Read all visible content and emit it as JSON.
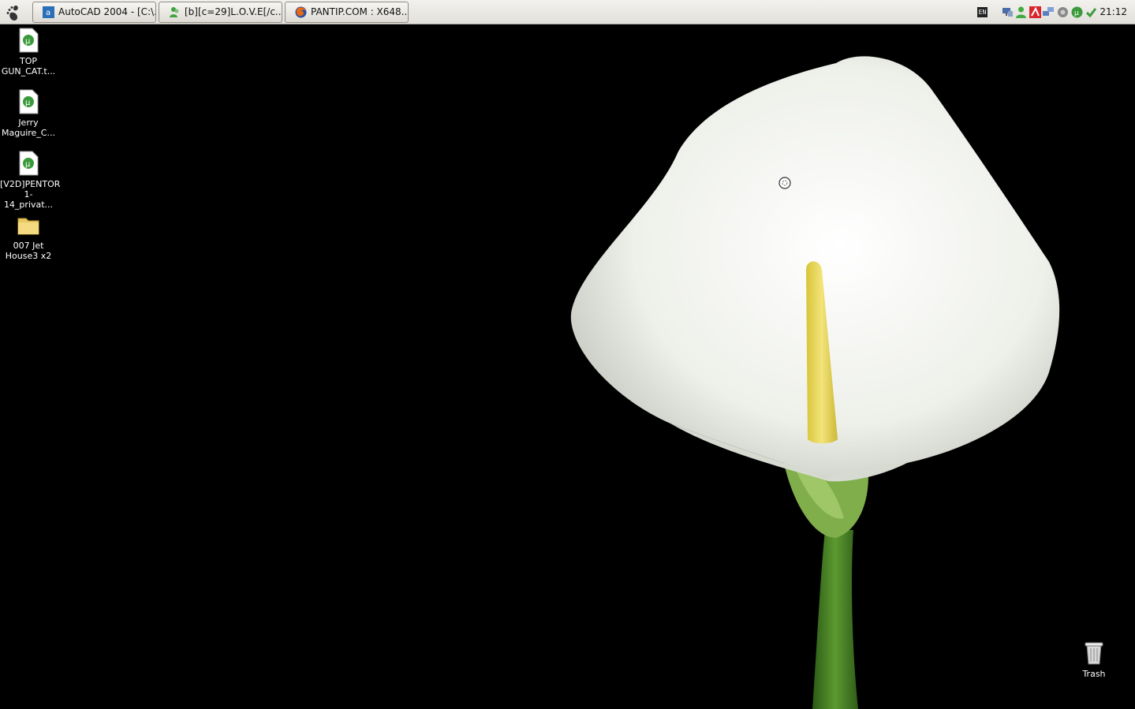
{
  "panel": {
    "tasks": [
      {
        "label": "AutoCAD 2004 - [C:\\...",
        "icon": "autocad-icon"
      },
      {
        "label": "[b][c=29]L.O.V.E[/c...",
        "icon": "messenger-icon"
      },
      {
        "label": "PANTIP.COM : X648...",
        "icon": "firefox-icon"
      }
    ],
    "language": "EN",
    "clock": "21:12"
  },
  "desktop": {
    "icons": [
      {
        "label": "TOP GUN_CAT.t...",
        "type": "torrent-file-icon"
      },
      {
        "label": "Jerry Maguire_C...",
        "type": "torrent-file-icon"
      },
      {
        "label": "[V2D]PENTOR 1-14_privat...",
        "type": "torrent-file-icon"
      },
      {
        "label": "007 Jet House3 x2",
        "type": "folder-icon"
      }
    ],
    "trash": {
      "label": "Trash"
    }
  },
  "colors": {
    "desktop_bg": "#000000",
    "panel_bg": "#e9e7e2",
    "flower": "#eef0ec",
    "spadix": "#e8d65a",
    "stem": "#3f7a22"
  }
}
